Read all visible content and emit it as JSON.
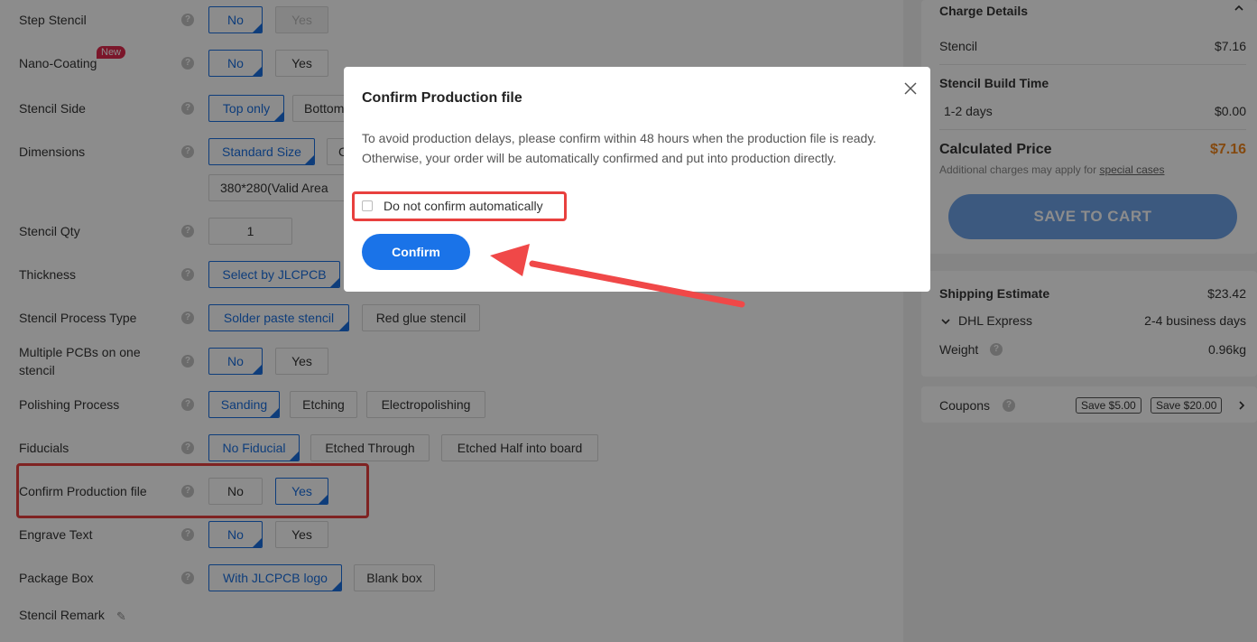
{
  "form": {
    "rows": [
      {
        "label": "Step Stencil",
        "options": [
          "No",
          "Yes"
        ]
      },
      {
        "label": "Nano-Coating",
        "badge": "New",
        "options": [
          "No",
          "Yes"
        ]
      },
      {
        "label": "Stencil Side",
        "options": [
          "Top only",
          "Bottom"
        ]
      },
      {
        "label": "Dimensions",
        "options": [
          "Standard Size",
          "C"
        ],
        "sub": "380*280(Valid Area"
      },
      {
        "label": "Stencil Qty",
        "qty": "1"
      },
      {
        "label": "Thickness",
        "options": [
          "Select by JLCPCB"
        ]
      },
      {
        "label": "Stencil Process Type",
        "options": [
          "Solder paste stencil",
          "Red glue stencil"
        ]
      },
      {
        "label": "Multiple PCBs on one stencil",
        "options": [
          "No",
          "Yes"
        ]
      },
      {
        "label": "Polishing Process",
        "options": [
          "Sanding",
          "Etching",
          "Electropolishing"
        ]
      },
      {
        "label": "Fiducials",
        "options": [
          "No Fiducial",
          "Etched Through",
          "Etched Half into board"
        ]
      },
      {
        "label": "Confirm Production file",
        "options": [
          "No",
          "Yes"
        ]
      },
      {
        "label": "Engrave Text",
        "options": [
          "No",
          "Yes"
        ]
      },
      {
        "label": "Package Box",
        "options": [
          "With JLCPCB logo",
          "Blank box"
        ]
      },
      {
        "label": "Stencil Remark"
      }
    ]
  },
  "sidebar": {
    "charge_title": "Charge Details",
    "stencil_label": "Stencil",
    "stencil_price": "$7.16",
    "build_title": "Stencil Build Time",
    "build_days": "1-2 days",
    "build_price": "$0.00",
    "calc_label": "Calculated Price",
    "calc_price": "$7.16",
    "additional_pre": "Additional charges may apply for ",
    "additional_link": "special cases",
    "cart_button": "SAVE TO CART",
    "shipping_label": "Shipping Estimate",
    "shipping_price": "$23.42",
    "carrier": "DHL Express",
    "carrier_time": "2-4 business days",
    "weight_label": "Weight",
    "weight_value": "0.96kg",
    "coupons_label": "Coupons",
    "coupon1": "Save $5.00",
    "coupon2": "Save $20.00"
  },
  "modal": {
    "title": "Confirm Production file",
    "body": "To avoid production delays, please confirm within 48 hours when the production file is ready. Otherwise, your order will be automatically confirmed and put into production directly.",
    "checkbox_label": "Do not confirm automatically",
    "confirm_button": "Confirm"
  },
  "colors": {
    "accent": "#1a73e8",
    "highlight": "#e8403e",
    "price": "#f0861c"
  }
}
